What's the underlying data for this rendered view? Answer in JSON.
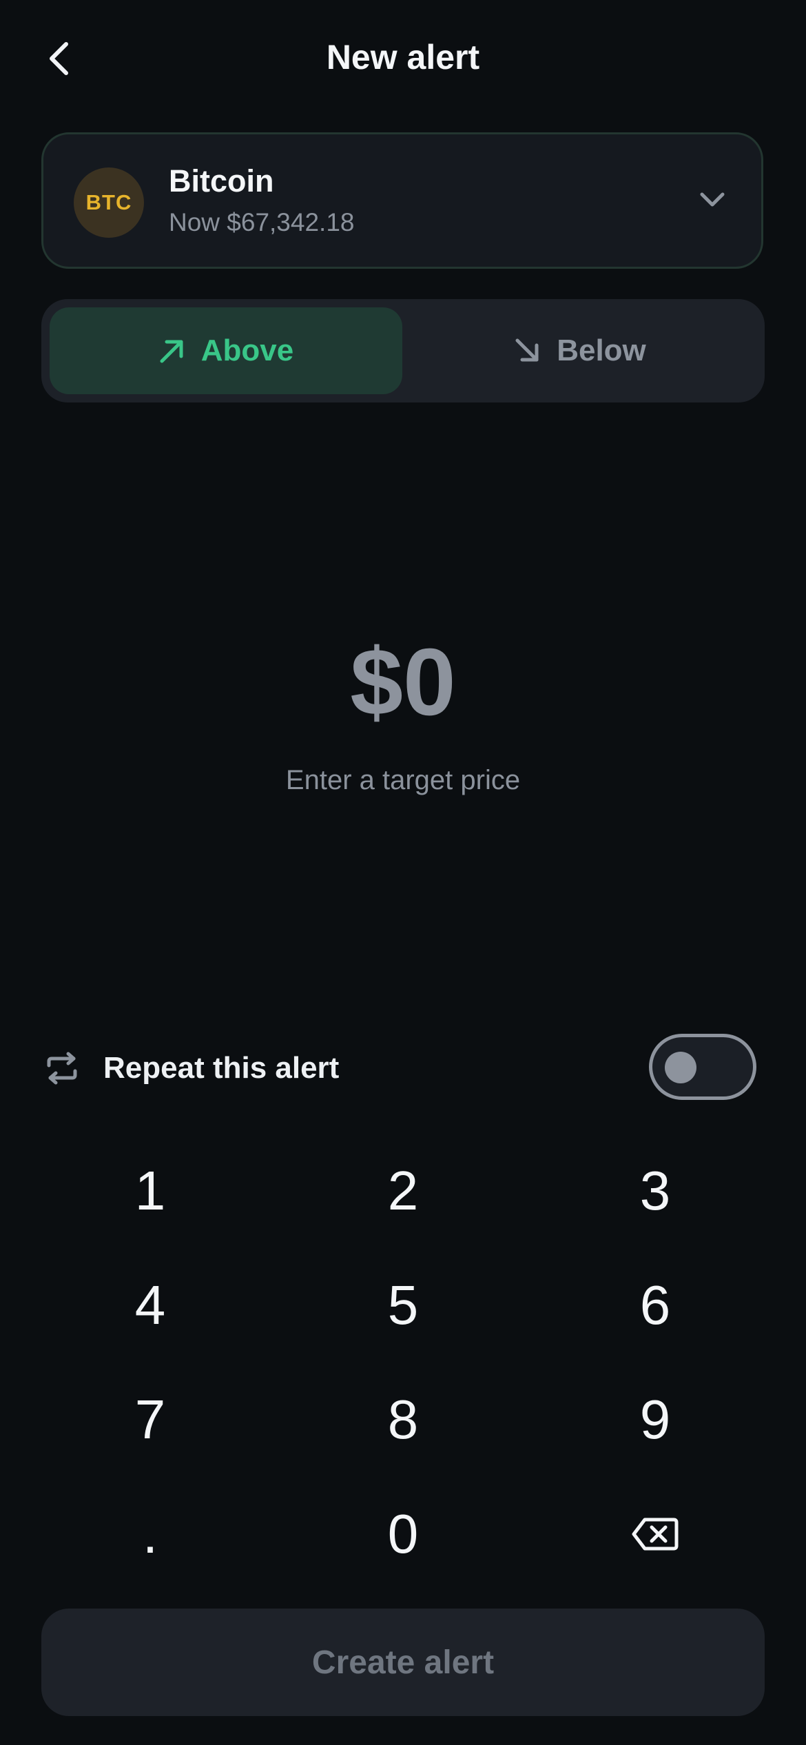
{
  "header": {
    "title": "New alert",
    "back_icon": "chevron-left-icon"
  },
  "coin": {
    "symbol": "BTC",
    "name": "Bitcoin",
    "price_text": "Now $67,342.18",
    "accent_color": "#e7b42c"
  },
  "direction": {
    "selected": "Above",
    "options": [
      {
        "label": "Above",
        "icon": "arrow-up-right-icon",
        "active": true
      },
      {
        "label": "Below",
        "icon": "arrow-down-right-icon",
        "active": false
      }
    ],
    "active_color": "#39c688"
  },
  "amount": {
    "value": "$0",
    "hint": "Enter a target price"
  },
  "repeat": {
    "label": "Repeat this alert",
    "enabled": false
  },
  "keypad": {
    "keys": [
      "1",
      "2",
      "3",
      "4",
      "5",
      "6",
      "7",
      "8",
      "9",
      ".",
      "0"
    ],
    "backspace_icon": "backspace-icon"
  },
  "create_button": {
    "label": "Create alert"
  }
}
